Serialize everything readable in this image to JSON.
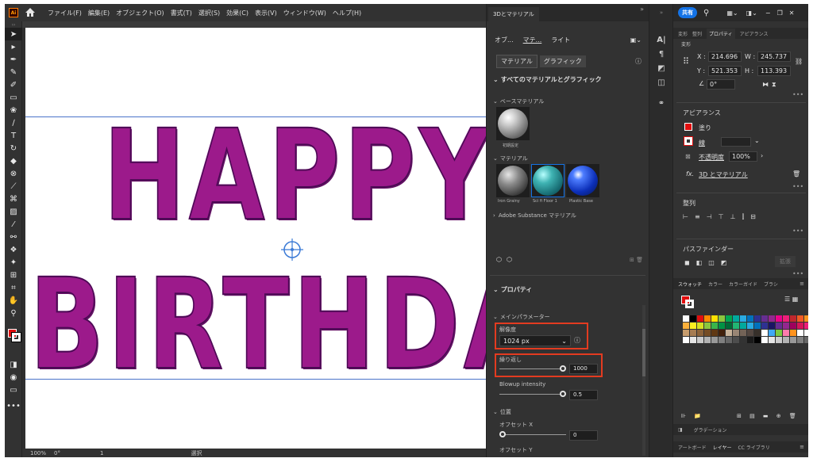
{
  "menubar": {
    "logo": "Ai",
    "items": [
      "ファイル(F)",
      "編集(E)",
      "オブジェクト(O)",
      "書式(T)",
      "選択(S)",
      "効果(C)",
      "表示(V)",
      "ウィンドウ(W)",
      "ヘルプ(H)"
    ]
  },
  "artwork": {
    "line1": "HAPPY",
    "line2": "BIRTHDA"
  },
  "statusbar": {
    "zoom": "100%",
    "angle": "0°",
    "artboard": "1",
    "tool": "選択"
  },
  "panel3d": {
    "tab": "3Dとマテリアル",
    "subtabs": [
      "オブ...",
      "マテ...",
      "ライト"
    ],
    "toggle": [
      "マテリアル",
      "グラフィック"
    ],
    "all_heading": "すべてのマテリアルとグラフィック",
    "base_heading": "ベースマテリアル",
    "base_item": "初期設定",
    "materials_heading": "マテリアル",
    "materials": [
      "Iron Grainy",
      "Sci fi Floor 1",
      "Plastic Base"
    ],
    "substance_heading": "Adobe Substance マテリアル",
    "properties_heading": "プロパティ",
    "main_params": "メインパラメーター",
    "resolution_label": "解像度",
    "resolution_value": "1024 px",
    "repeat_label": "繰り返し",
    "repeat_value": "1000",
    "repeat_fraction": 1.0,
    "blowup_label": "Blowup intensity",
    "blowup_value": "0.5",
    "blowup_fraction": 1.0,
    "position_heading": "位置",
    "offset_x_label": "オフセット X",
    "offset_x_value": "0",
    "offset_y_label": "オフセット Y"
  },
  "panelr": {
    "share": "共有",
    "tabs": [
      "変形",
      "整列",
      "プロパティ",
      "アピアランス"
    ],
    "transform_heading": "変形",
    "x_label": "X :",
    "x_value": "214.696",
    "y_label": "Y :",
    "y_value": "521.353",
    "w_label": "W :",
    "w_value": "245.737",
    "h_label": "H :",
    "h_value": "113.393",
    "angle_value": "0°",
    "appearance_heading": "アピアランス",
    "fill_label": "塗り",
    "stroke_label": "線",
    "opacity_label": "不透明度",
    "opacity_value": "100%",
    "fx_label": "3D とマテリアル",
    "align_heading": "整列",
    "pathfinder_heading": "パスファインダー",
    "pathfinder_btn": "拡張",
    "swatch_tabs": [
      "スウォッチ",
      "カラー",
      "カラーガイド",
      "ブラシ"
    ],
    "gradient_tab": "グラデーション",
    "bottom_tabs": [
      "アートボード",
      "レイヤー",
      "CC ライブラリ"
    ]
  },
  "colors": {
    "accent": "#1473e6",
    "highlight": "#e33b20",
    "art": "#9c1a8b",
    "fill": "#e10e0e"
  }
}
